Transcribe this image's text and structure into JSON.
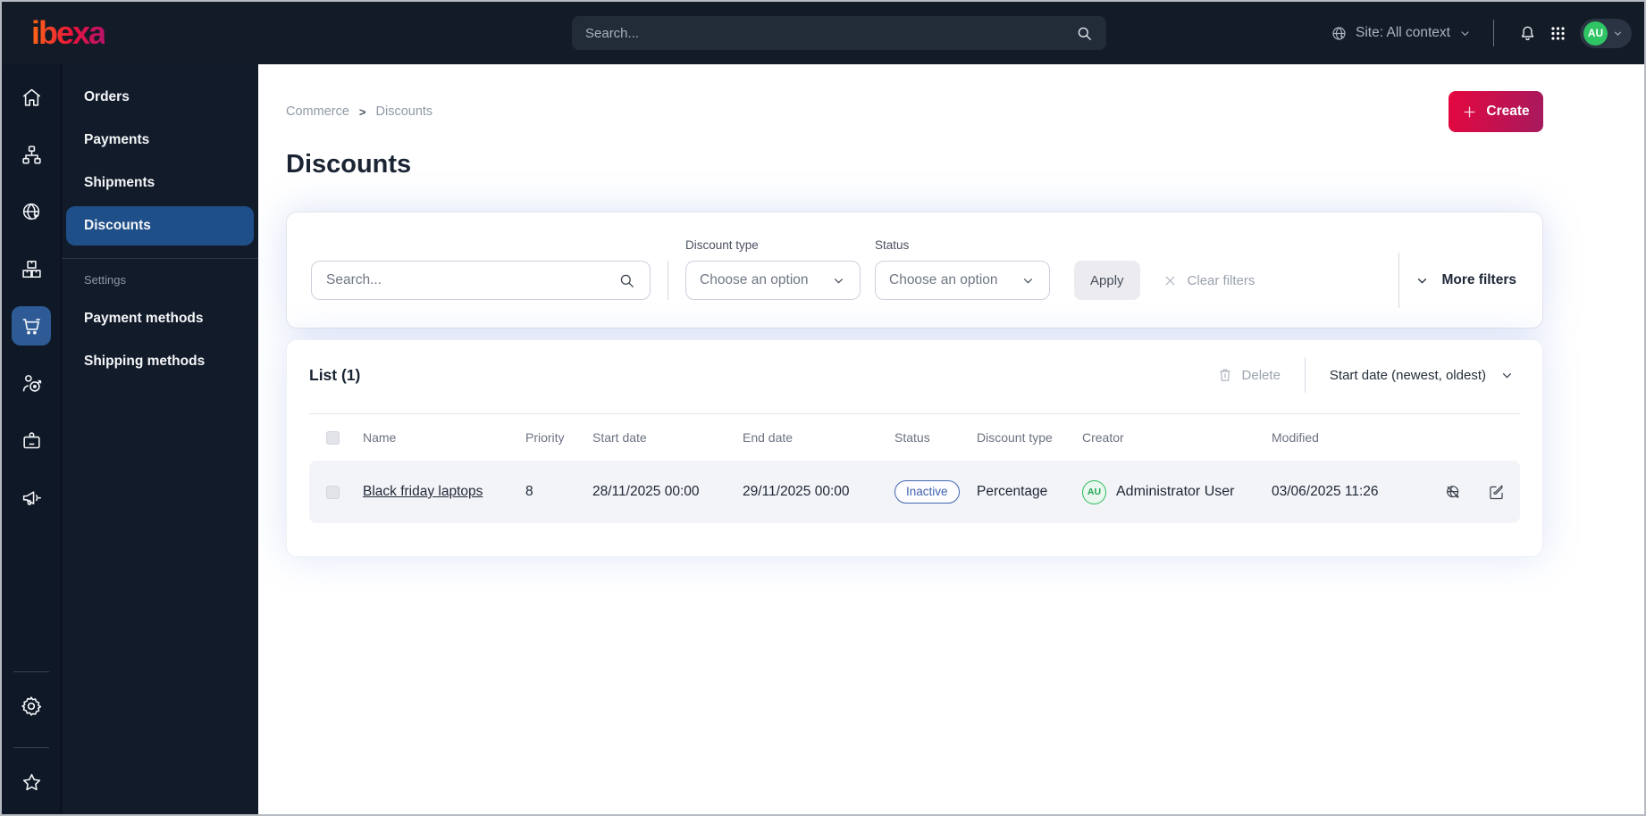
{
  "topbar": {
    "brand": "ibexa",
    "search_placeholder": "Search...",
    "site_context": "Site: All context",
    "avatar_initials": "AU",
    "icons": [
      "site-globe-icon",
      "bell-icon",
      "app-grid-icon",
      "chevron-down-icon"
    ]
  },
  "sidebar": {
    "icons": [
      "home-icon",
      "content-tree-icon",
      "site-globe-cursor-icon",
      "products-boxes-icon",
      "commerce-cart-icon",
      "customer-target-icon",
      "user-badge-icon",
      "marketing-megaphone-icon",
      "settings-gear-icon",
      "bookmarks-star-icon"
    ],
    "active_icon": "commerce-cart-icon"
  },
  "menu": {
    "items": [
      {
        "label": "Orders"
      },
      {
        "label": "Payments"
      },
      {
        "label": "Shipments"
      },
      {
        "label": "Discounts",
        "active": true
      }
    ],
    "section_label": "Settings",
    "settings_items": [
      {
        "label": "Payment methods"
      },
      {
        "label": "Shipping methods"
      }
    ]
  },
  "breadcrumb": {
    "items": [
      "Commerce",
      "Discounts"
    ],
    "separator": ">"
  },
  "page": {
    "title": "Discounts",
    "create_label": "Create"
  },
  "filters": {
    "search_placeholder": "Search...",
    "discount_type_label": "Discount type",
    "discount_type_value": "Choose an option",
    "status_label": "Status",
    "status_value": "Choose an option",
    "apply_label": "Apply",
    "clear_label": "Clear filters",
    "more_label": "More filters"
  },
  "list": {
    "title": "List (1)",
    "delete_label": "Delete",
    "sort_label": "Start date (newest, oldest)",
    "columns": [
      "Name",
      "Priority",
      "Start date",
      "End date",
      "Status",
      "Discount type",
      "Creator",
      "Modified"
    ],
    "rows": [
      {
        "name": "Black friday laptops",
        "priority": "8",
        "start_date": "28/11/2025 00:00",
        "end_date": "29/11/2025 00:00",
        "status": "Inactive",
        "discount_type": "Percentage",
        "creator_initials": "AU",
        "creator": "Administrator User",
        "modified": "03/06/2025 11:26",
        "action_icons": [
          "preview-disabled-icon",
          "edit-icon"
        ]
      }
    ]
  },
  "colors": {
    "topbar_bg": "#131b27",
    "rail_bg": "#0f1826",
    "panel_bg": "#121b2a",
    "active_blue": "#1f4f88",
    "rail_active_blue": "#2e5b96",
    "brand_gradient_start": "#ff6a13",
    "brand_gradient_end": "#b5136b",
    "create_gradient_start": "#e5073f",
    "create_gradient_end": "#a61a5e",
    "badge_blue": "#4062ae",
    "avatar_green": "#2cb95e",
    "row_bg": "#f3f4f7"
  }
}
